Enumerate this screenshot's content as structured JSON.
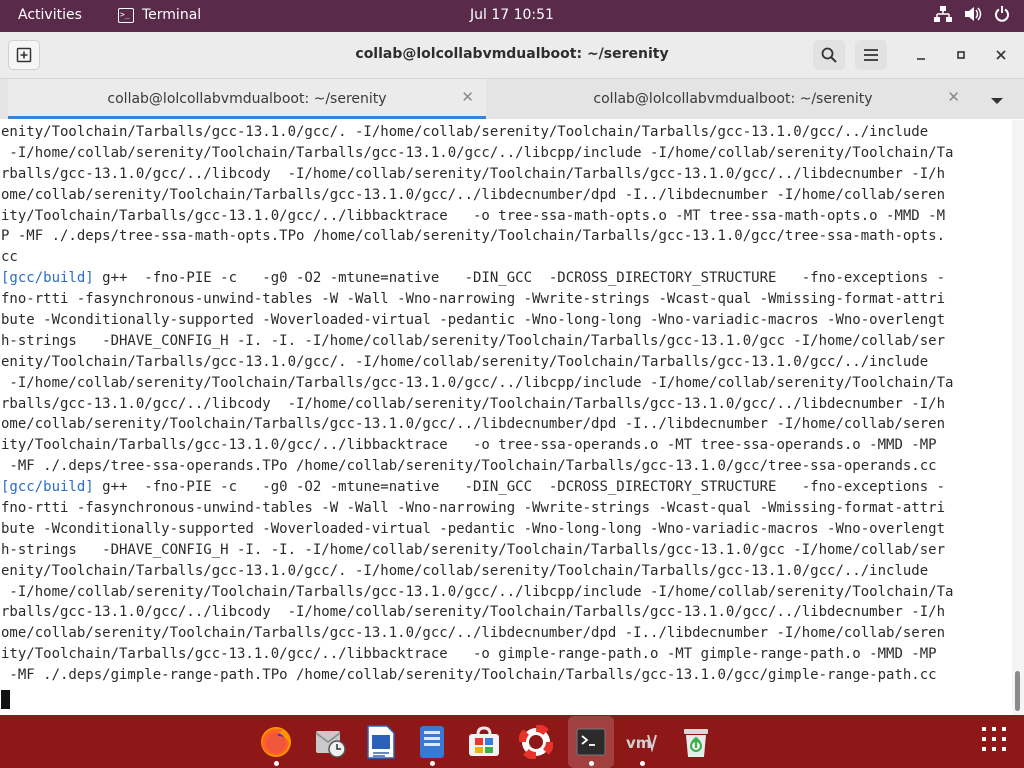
{
  "topbar": {
    "activities": "Activities",
    "app_name": "Terminal",
    "clock": "Jul 17  10:51"
  },
  "window": {
    "title": "collab@lolcollabvmdualboot: ~/serenity"
  },
  "tabs": [
    {
      "label": "collab@lolcollabvmdualboot: ~/serenity",
      "active": true
    },
    {
      "label": "collab@lolcollabvmdualboot: ~/serenity",
      "active": false
    }
  ],
  "terminal": {
    "lines": [
      {
        "tag": "",
        "text": "enity/Toolchain/Tarballs/gcc-13.1.0/gcc/. -I/home/collab/serenity/Toolchain/Tarballs/gcc-13.1.0/gcc/../include"
      },
      {
        "tag": "",
        "text": " -I/home/collab/serenity/Toolchain/Tarballs/gcc-13.1.0/gcc/../libcpp/include -I/home/collab/serenity/Toolchain/Ta"
      },
      {
        "tag": "",
        "text": "rballs/gcc-13.1.0/gcc/../libcody  -I/home/collab/serenity/Toolchain/Tarballs/gcc-13.1.0/gcc/../libdecnumber -I/h"
      },
      {
        "tag": "",
        "text": "ome/collab/serenity/Toolchain/Tarballs/gcc-13.1.0/gcc/../libdecnumber/dpd -I../libdecnumber -I/home/collab/seren"
      },
      {
        "tag": "",
        "text": "ity/Toolchain/Tarballs/gcc-13.1.0/gcc/../libbacktrace   -o tree-ssa-math-opts.o -MT tree-ssa-math-opts.o -MMD -M"
      },
      {
        "tag": "",
        "text": "P -MF ./.deps/tree-ssa-math-opts.TPo /home/collab/serenity/Toolchain/Tarballs/gcc-13.1.0/gcc/tree-ssa-math-opts."
      },
      {
        "tag": "",
        "text": "cc"
      },
      {
        "tag": "[gcc/build]",
        "text": " g++  -fno-PIE -c   -g0 -O2 -mtune=native   -DIN_GCC  -DCROSS_DIRECTORY_STRUCTURE   -fno-exceptions -"
      },
      {
        "tag": "",
        "text": "fno-rtti -fasynchronous-unwind-tables -W -Wall -Wno-narrowing -Wwrite-strings -Wcast-qual -Wmissing-format-attri"
      },
      {
        "tag": "",
        "text": "bute -Wconditionally-supported -Woverloaded-virtual -pedantic -Wno-long-long -Wno-variadic-macros -Wno-overlengt"
      },
      {
        "tag": "",
        "text": "h-strings   -DHAVE_CONFIG_H -I. -I. -I/home/collab/serenity/Toolchain/Tarballs/gcc-13.1.0/gcc -I/home/collab/ser"
      },
      {
        "tag": "",
        "text": "enity/Toolchain/Tarballs/gcc-13.1.0/gcc/. -I/home/collab/serenity/Toolchain/Tarballs/gcc-13.1.0/gcc/../include"
      },
      {
        "tag": "",
        "text": " -I/home/collab/serenity/Toolchain/Tarballs/gcc-13.1.0/gcc/../libcpp/include -I/home/collab/serenity/Toolchain/Ta"
      },
      {
        "tag": "",
        "text": "rballs/gcc-13.1.0/gcc/../libcody  -I/home/collab/serenity/Toolchain/Tarballs/gcc-13.1.0/gcc/../libdecnumber -I/h"
      },
      {
        "tag": "",
        "text": "ome/collab/serenity/Toolchain/Tarballs/gcc-13.1.0/gcc/../libdecnumber/dpd -I../libdecnumber -I/home/collab/seren"
      },
      {
        "tag": "",
        "text": "ity/Toolchain/Tarballs/gcc-13.1.0/gcc/../libbacktrace   -o tree-ssa-operands.o -MT tree-ssa-operands.o -MMD -MP"
      },
      {
        "tag": "",
        "text": " -MF ./.deps/tree-ssa-operands.TPo /home/collab/serenity/Toolchain/Tarballs/gcc-13.1.0/gcc/tree-ssa-operands.cc"
      },
      {
        "tag": "[gcc/build]",
        "text": " g++  -fno-PIE -c   -g0 -O2 -mtune=native   -DIN_GCC  -DCROSS_DIRECTORY_STRUCTURE   -fno-exceptions -"
      },
      {
        "tag": "",
        "text": "fno-rtti -fasynchronous-unwind-tables -W -Wall -Wno-narrowing -Wwrite-strings -Wcast-qual -Wmissing-format-attri"
      },
      {
        "tag": "",
        "text": "bute -Wconditionally-supported -Woverloaded-virtual -pedantic -Wno-long-long -Wno-variadic-macros -Wno-overlengt"
      },
      {
        "tag": "",
        "text": "h-strings   -DHAVE_CONFIG_H -I. -I. -I/home/collab/serenity/Toolchain/Tarballs/gcc-13.1.0/gcc -I/home/collab/ser"
      },
      {
        "tag": "",
        "text": "enity/Toolchain/Tarballs/gcc-13.1.0/gcc/. -I/home/collab/serenity/Toolchain/Tarballs/gcc-13.1.0/gcc/../include"
      },
      {
        "tag": "",
        "text": " -I/home/collab/serenity/Toolchain/Tarballs/gcc-13.1.0/gcc/../libcpp/include -I/home/collab/serenity/Toolchain/Ta"
      },
      {
        "tag": "",
        "text": "rballs/gcc-13.1.0/gcc/../libcody  -I/home/collab/serenity/Toolchain/Tarballs/gcc-13.1.0/gcc/../libdecnumber -I/h"
      },
      {
        "tag": "",
        "text": "ome/collab/serenity/Toolchain/Tarballs/gcc-13.1.0/gcc/../libdecnumber/dpd -I../libdecnumber -I/home/collab/seren"
      },
      {
        "tag": "",
        "text": "ity/Toolchain/Tarballs/gcc-13.1.0/gcc/../libbacktrace   -o gimple-range-path.o -MT gimple-range-path.o -MMD -MP"
      },
      {
        "tag": "",
        "text": " -MF ./.deps/gimple-range-path.TPo /home/collab/serenity/Toolchain/Tarballs/gcc-13.1.0/gcc/gimple-range-path.cc"
      }
    ]
  },
  "dock": {
    "items": [
      {
        "name": "firefox",
        "icon": "firefox-icon",
        "running": true
      },
      {
        "name": "evolution",
        "icon": "mail-clock-icon",
        "running": false
      },
      {
        "name": "libreoffice-writer",
        "icon": "document-icon",
        "running": false
      },
      {
        "name": "files",
        "icon": "file-manager-icon",
        "running": true
      },
      {
        "name": "software",
        "icon": "software-center-icon",
        "running": false
      },
      {
        "name": "help",
        "icon": "lifebuoy-icon",
        "running": false
      },
      {
        "name": "terminal",
        "icon": "terminal-icon",
        "running": true
      },
      {
        "name": "vmware",
        "icon": "vm-icon",
        "running": true
      },
      {
        "name": "trash",
        "icon": "trash-icon",
        "running": false
      }
    ]
  },
  "colors": {
    "topbar": "#5a2a4a",
    "dock": "#8e1717",
    "accent": "#3584e4",
    "prompt_tag": "#2a6cc8"
  }
}
